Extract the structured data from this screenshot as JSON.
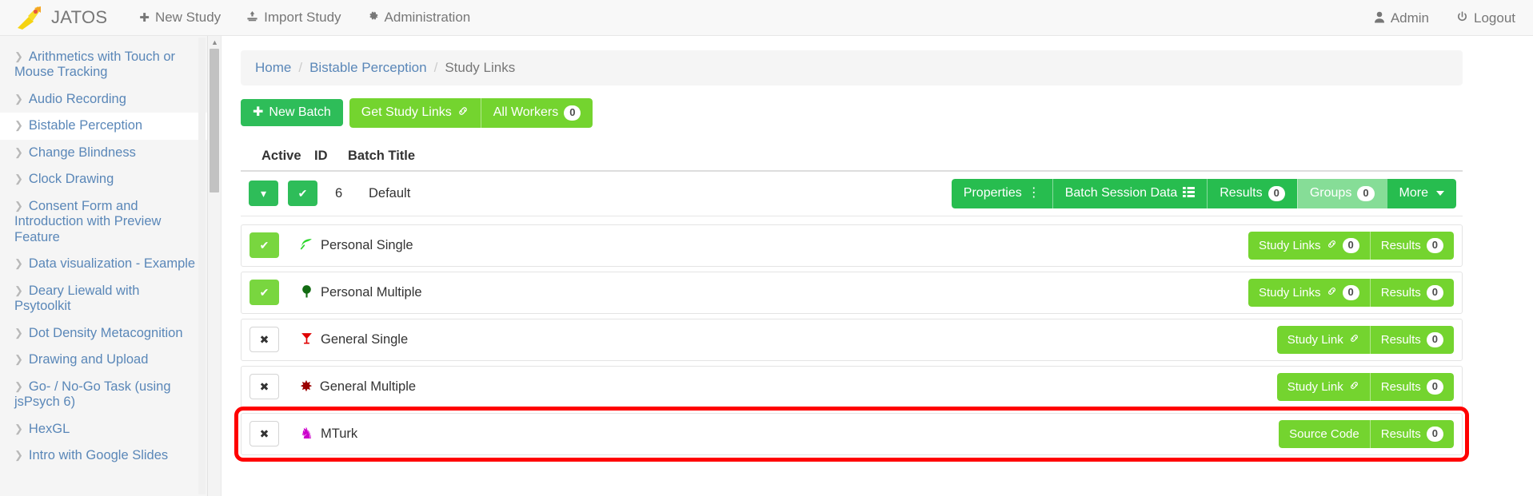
{
  "navbar": {
    "brand": "JATOS",
    "brand_icon": "jatos-rocket-logo",
    "links": [
      {
        "label": "New Study",
        "icon": "plus-icon"
      },
      {
        "label": "Import Study",
        "icon": "import-icon"
      },
      {
        "label": "Administration",
        "icon": "gear-icon"
      }
    ],
    "right_links": [
      {
        "label": "Admin",
        "icon": "user-icon"
      },
      {
        "label": "Logout",
        "icon": "power-icon"
      }
    ]
  },
  "sidebar": {
    "items": [
      {
        "label": "Arithmetics with Touch or Mouse Tracking",
        "active": false
      },
      {
        "label": "Audio Recording",
        "active": false
      },
      {
        "label": "Bistable Perception",
        "active": true
      },
      {
        "label": "Change Blindness",
        "active": false
      },
      {
        "label": "Clock Drawing",
        "active": false
      },
      {
        "label": "Consent Form and Introduction with Preview Feature",
        "active": false
      },
      {
        "label": "Data visualization - Example",
        "active": false
      },
      {
        "label": "Deary Liewald with Psytoolkit",
        "active": false
      },
      {
        "label": "Dot Density Metacognition",
        "active": false
      },
      {
        "label": "Drawing and Upload",
        "active": false
      },
      {
        "label": "Go- / No-Go Task (using jsPsych 6)",
        "active": false
      },
      {
        "label": "HexGL",
        "active": false
      },
      {
        "label": "Intro with Google Slides",
        "active": false
      }
    ]
  },
  "breadcrumb": {
    "items": [
      {
        "label": "Home",
        "current": false
      },
      {
        "label": "Bistable Perception",
        "current": false
      },
      {
        "label": "Study Links",
        "current": true
      }
    ],
    "separator": "/"
  },
  "toolbar": {
    "new_batch_label": "New Batch",
    "new_batch_icon": "plus-icon",
    "get_study_links_label": "Get Study Links",
    "get_study_links_icon": "link-icon",
    "all_workers_label": "All Workers",
    "all_workers_count": "0"
  },
  "table": {
    "headers": {
      "active": "Active",
      "id": "ID",
      "title": "Batch Title"
    },
    "batch": {
      "toggle_icon": "chevron-down-icon",
      "active_icon": "check-icon",
      "id": "6",
      "title": "Default",
      "actions": [
        {
          "label": "Properties",
          "icon": "vertical-dots-icon",
          "style": "green",
          "count": null
        },
        {
          "label": "Batch Session Data",
          "icon": "table-icon",
          "style": "green",
          "count": null
        },
        {
          "label": "Results",
          "icon": null,
          "style": "green",
          "count": "0"
        },
        {
          "label": "Groups",
          "icon": null,
          "style": "pale",
          "count": "0"
        },
        {
          "label": "More",
          "icon": "caret-down-icon",
          "style": "green",
          "count": null
        }
      ]
    },
    "workers": [
      {
        "enabled": true,
        "toggle_icon": "check-icon",
        "type_icon": "leaf-icon",
        "type_icon_glyph": "❦",
        "type_icon_color": "#2bd62b",
        "label": "Personal Single",
        "actions": [
          {
            "label": "Study Links",
            "icon": "link-icon",
            "count": "0",
            "style": "light"
          },
          {
            "label": "Results",
            "icon": null,
            "count": "0",
            "style": "light"
          }
        ],
        "highlight": false
      },
      {
        "enabled": true,
        "toggle_icon": "check-icon",
        "type_icon": "tree-icon",
        "type_icon_glyph": "☘",
        "type_icon_color": "#126b12",
        "label": "Personal Multiple",
        "actions": [
          {
            "label": "Study Links",
            "icon": "link-icon",
            "count": "0",
            "style": "light"
          },
          {
            "label": "Results",
            "icon": null,
            "count": "0",
            "style": "light"
          }
        ],
        "highlight": false
      },
      {
        "enabled": false,
        "toggle_icon": "close-icon",
        "type_icon": "cocktail-icon",
        "type_icon_glyph": "ἷ8",
        "type_icon_color": "#e00000",
        "label": "General Single",
        "actions": [
          {
            "label": "Study Link",
            "icon": "link-icon",
            "count": null,
            "style": "light"
          },
          {
            "label": "Results",
            "icon": null,
            "count": "0",
            "style": "light"
          }
        ],
        "highlight": false
      },
      {
        "enabled": false,
        "toggle_icon": "close-icon",
        "type_icon": "asterisk-flower-icon",
        "type_icon_glyph": "✸",
        "type_icon_color": "#9b0000",
        "label": "General Multiple",
        "actions": [
          {
            "label": "Study Link",
            "icon": "link-icon",
            "count": null,
            "style": "light"
          },
          {
            "label": "Results",
            "icon": null,
            "count": "0",
            "style": "light"
          }
        ],
        "highlight": false
      },
      {
        "enabled": false,
        "toggle_icon": "close-icon",
        "type_icon": "chess-knight-icon",
        "type_icon_glyph": "♞",
        "type_icon_color": "#cc00cc",
        "label": "MTurk",
        "actions": [
          {
            "label": "Source Code",
            "icon": null,
            "count": null,
            "style": "light"
          },
          {
            "label": "Results",
            "icon": null,
            "count": "0",
            "style": "light"
          }
        ],
        "highlight": true
      }
    ]
  },
  "colors": {
    "brand_yellow": "#f5d312",
    "dark_green": "#2ebd59",
    "light_green": "#74d42f",
    "pale_green": "#86dd97",
    "link_blue": "#5a87b8",
    "highlight_red": "#ff0000"
  }
}
